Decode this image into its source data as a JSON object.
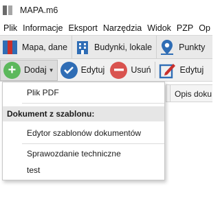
{
  "window": {
    "title": "MAPA.m6",
    "app_icon": "map-layers-icon"
  },
  "menu": [
    "Plik",
    "Informacje",
    "Eksport",
    "Narzędzia",
    "Widok",
    "PZP",
    "Op"
  ],
  "modules": [
    {
      "label": "Mapa, dane",
      "icon": "map-icon"
    },
    {
      "label": "Budynki, lokale",
      "icon": "building-icon"
    },
    {
      "label": "Punkty",
      "icon": "location-pin-icon"
    }
  ],
  "toolbar": {
    "add_label": "Dodaj",
    "edit_label": "Edytuj",
    "delete_label": "Usuń",
    "edit2_label": "Edytuj"
  },
  "grid": {
    "column_header": "Opis doku"
  },
  "dropdown": {
    "pdf": "Plik PDF",
    "section_header": "Dokument z szablonu:",
    "template_editor": "Edytor szablonów dokumentów",
    "technical_report": "Sprawozdanie techniczne",
    "test": "test"
  },
  "colors": {
    "add": "#5cb85c",
    "edit": "#2f6db5",
    "delete": "#d9534f",
    "edit2": "#2f6db5",
    "pin": "#2f6db5"
  }
}
